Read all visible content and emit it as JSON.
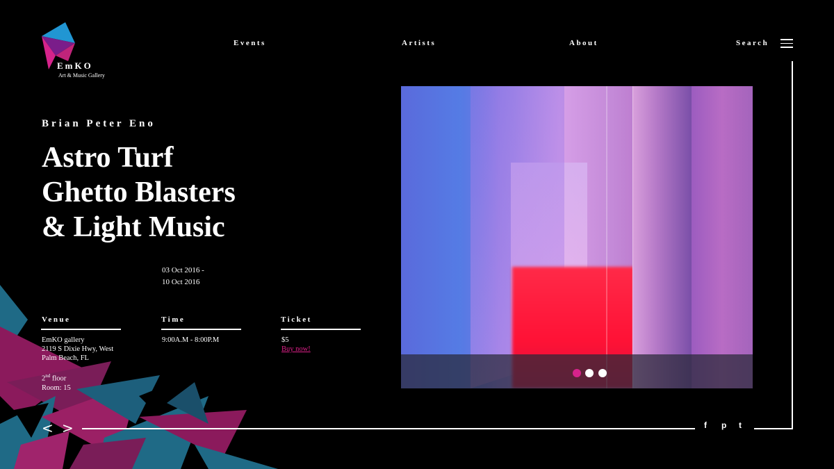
{
  "brand": {
    "name": "EmKO",
    "tagline": "Art & Music Gallery"
  },
  "nav": {
    "events": "Events",
    "artists": "Artists",
    "about": "About",
    "search": "Search"
  },
  "hero": {
    "artist": "Brian Peter Eno",
    "title_lines": [
      "Astro Turf",
      "Ghetto Blasters",
      "& Light Music"
    ],
    "date_start": "03 Oct 2016 -",
    "date_end": "10 Oct 2016"
  },
  "info": {
    "venue": {
      "heading": "Venue",
      "lines": [
        "EmKO gallery",
        "2119 S Dixie Hwy, West",
        "Palm Beach, FL"
      ],
      "floor_num": "2",
      "floor_sup": "nd",
      "floor_label": " floor",
      "room": "Room: 15"
    },
    "time": {
      "heading": "Time",
      "value": "9:00A.M - 8:00P.M"
    },
    "ticket": {
      "heading": "Ticket",
      "price": "$5",
      "buy": "Buy now!"
    }
  },
  "carousel": {
    "slide_count": 3,
    "active_index": 0,
    "active_color": "#d6238b",
    "inactive_color": "#ffffff"
  },
  "pager": {
    "prev": "<",
    "next": ">"
  },
  "social": {
    "facebook": "f",
    "pinterest": "p",
    "twitter": "t"
  },
  "colors": {
    "accent": "#e0208a",
    "teal": "#1f6a86",
    "magenta": "#8b1a5c"
  }
}
